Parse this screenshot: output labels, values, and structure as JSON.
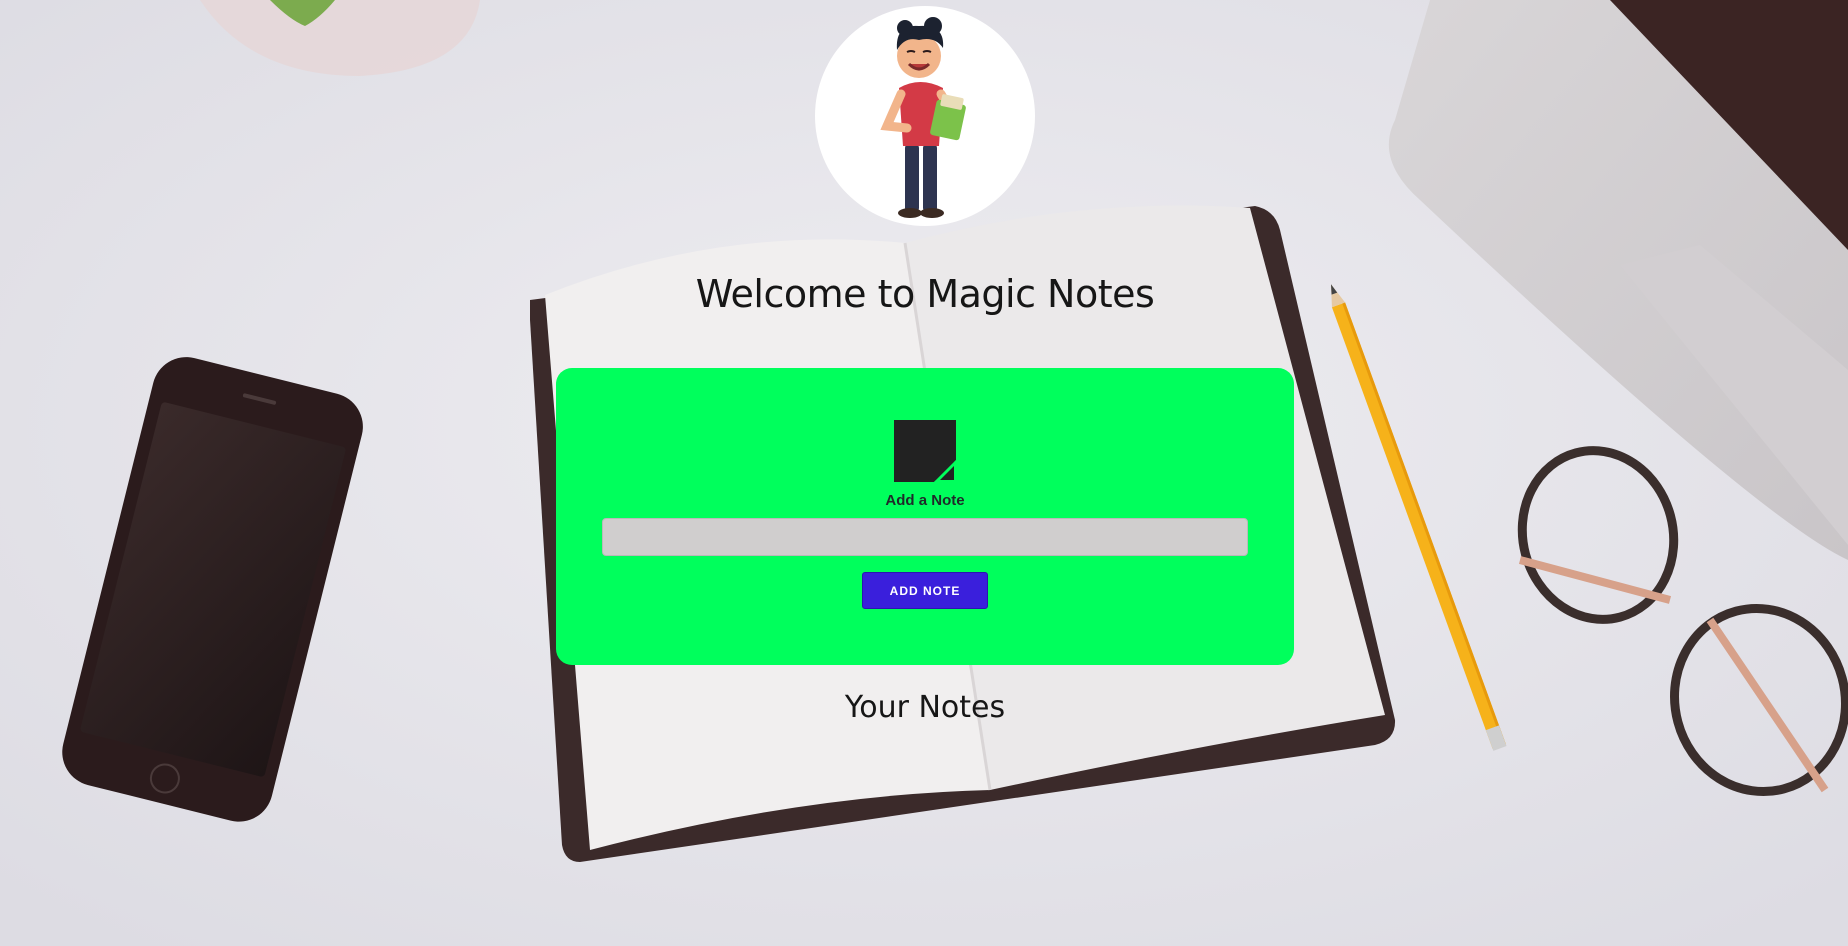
{
  "header": {
    "title": "Welcome to Magic Notes",
    "avatar_icon": "person-with-clipboard-icon"
  },
  "add_note": {
    "icon": "sticky-note-icon",
    "label": "Add a Note",
    "input_value": "",
    "button_label": "ADD NOTE"
  },
  "notes": {
    "heading": "Your Notes",
    "items": []
  },
  "colors": {
    "card": "#00ff5c",
    "button": "#3a1fdc",
    "input": "#d0cece",
    "background": "#e6e5ea"
  }
}
